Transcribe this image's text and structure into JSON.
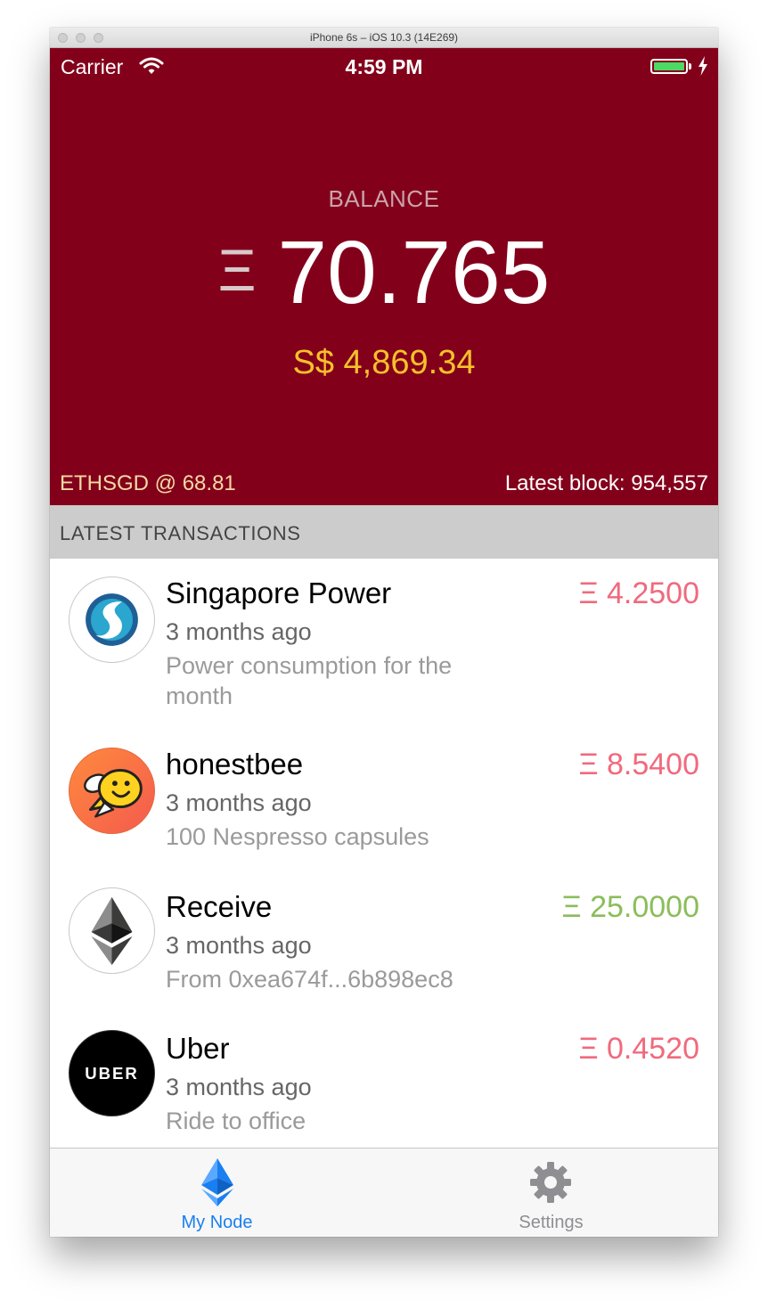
{
  "window": {
    "title": "iPhone 6s – iOS 10.3 (14E269)"
  },
  "status_bar": {
    "carrier": "Carrier",
    "time": "4:59 PM"
  },
  "balance": {
    "label": "BALANCE",
    "symbol": "Ξ",
    "value": "70.765",
    "fiat": "S$ 4,869.34"
  },
  "footer": {
    "rate": "ETHSGD @ 68.81",
    "latest_block": "Latest block: 954,557"
  },
  "section_header": "LATEST TRANSACTIONS",
  "transactions": [
    {
      "name": "Singapore Power",
      "time": "3 months ago",
      "description": "Power consumption for the month",
      "amount": "Ξ 4.2500",
      "direction": "out",
      "icon": "singapore-power-logo"
    },
    {
      "name": "honestbee",
      "time": "3 months ago",
      "description": "100 Nespresso capsules",
      "amount": "Ξ 8.5400",
      "direction": "out",
      "icon": "honestbee-logo"
    },
    {
      "name": "Receive",
      "time": "3 months ago",
      "description": "From 0xea674f...6b898ec8",
      "amount": "Ξ 25.0000",
      "direction": "in",
      "icon": "ethereum-logo"
    },
    {
      "name": "Uber",
      "time": "3 months ago",
      "description": "Ride to office",
      "amount": "Ξ 0.4520",
      "direction": "out",
      "icon": "uber-logo",
      "logo_text": "UBER"
    }
  ],
  "tabs": [
    {
      "label": "My Node",
      "icon": "ethereum-icon",
      "active": true
    },
    {
      "label": "Settings",
      "icon": "gear-icon",
      "active": false
    }
  ],
  "colors": {
    "hero_bg": "#83001b",
    "fiat": "#f7c12a",
    "outgoing": "#f06a7d",
    "incoming": "#8bbd5a",
    "tab_active": "#1a7ff0",
    "tab_inactive": "#8e8e93"
  }
}
